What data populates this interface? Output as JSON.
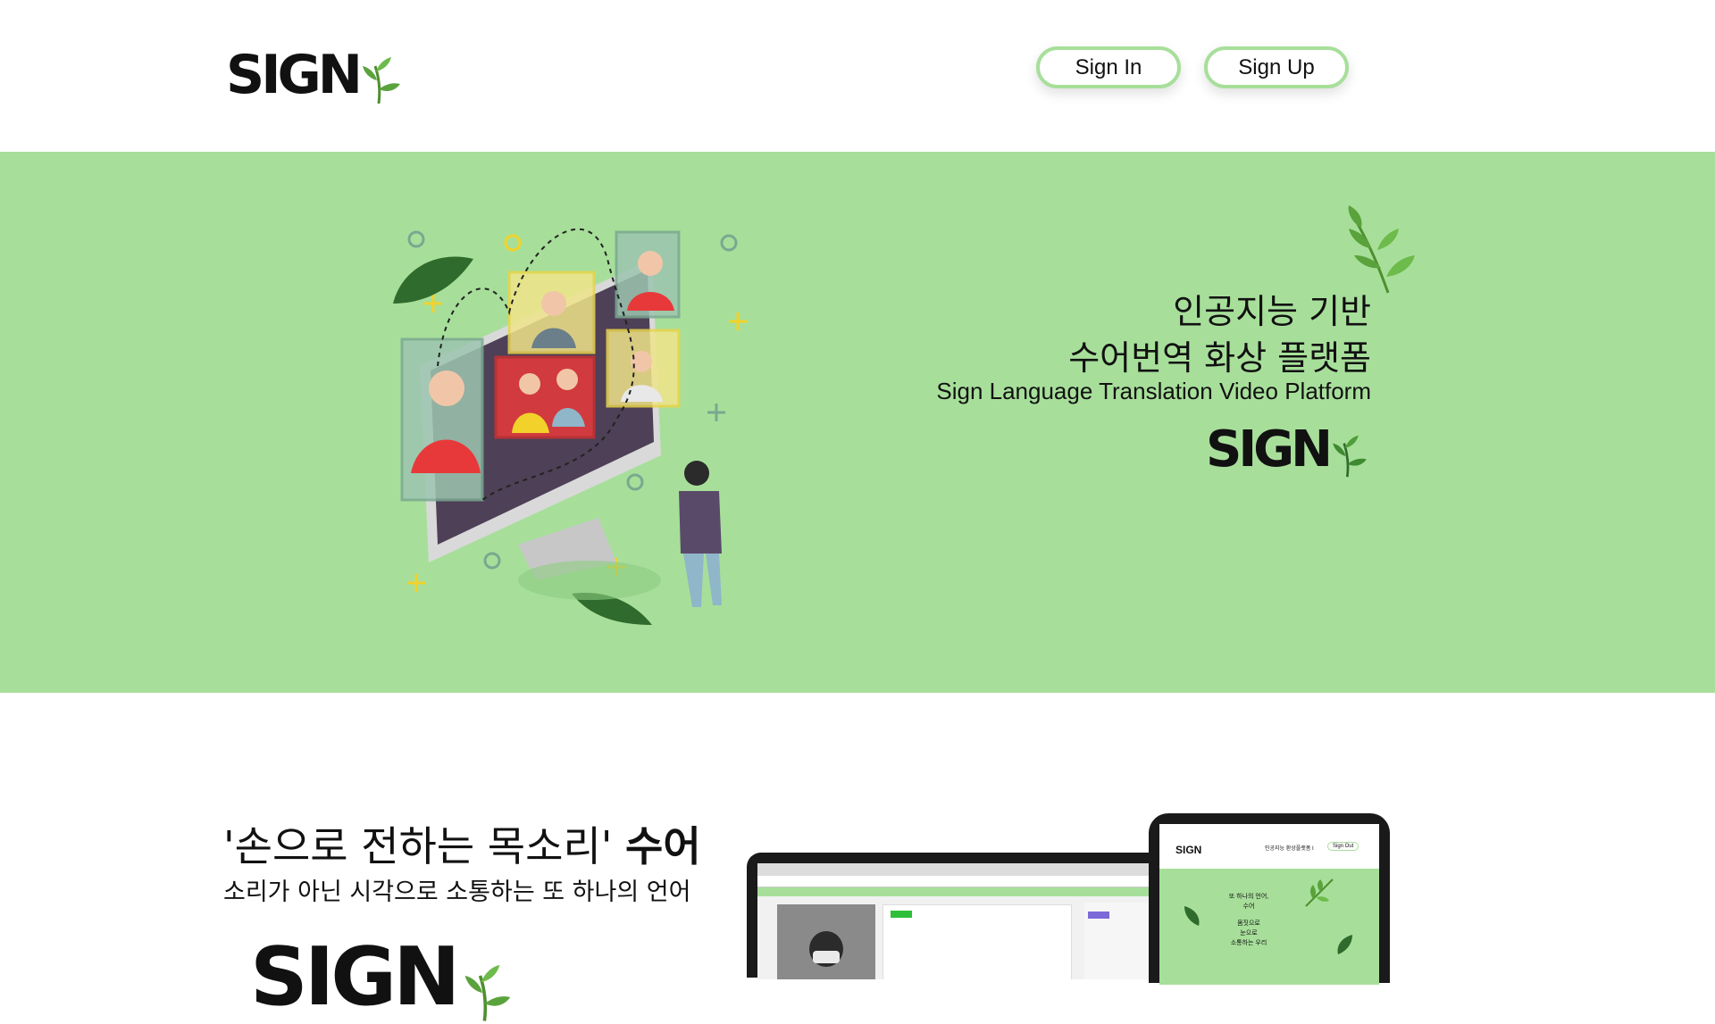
{
  "header": {
    "logo_text": "SIGN",
    "sign_in_label": "Sign In",
    "sign_up_label": "Sign Up"
  },
  "hero": {
    "title_line1": "인공지능 기반",
    "title_line2": "수어번역 화상 플랫폼",
    "subtitle": "Sign Language Translation Video Platform",
    "logo_text": "SIGN"
  },
  "feature": {
    "heading_quote": "'손으로 전하는 목소리'",
    "heading_strong": "수어",
    "subheading": "소리가 아닌 시각으로 소통하는 또 하나의 언어",
    "logo_text": "SIGN"
  },
  "tablet_preview": {
    "logo_text": "SIGN",
    "nav_text": "인공지능 환상플랫폼 I",
    "button_label": "Sign Out",
    "line1": "또 하나의 언어,",
    "line2": "수어",
    "line3": "몸짓으로",
    "line4": "눈으로",
    "line5": "소통하는 우리"
  },
  "colors": {
    "brand_green": "#a7df9a",
    "leaf_green": "#5aa33c",
    "text": "#111111"
  }
}
